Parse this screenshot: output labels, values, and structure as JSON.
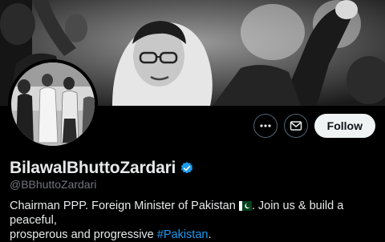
{
  "profile": {
    "display_name": "BilawalBhuttoZardari",
    "handle": "@BBhuttoZardari",
    "verified": true,
    "bio_lines": {
      "part1": "Chairman PPP. Foreign Minister of Pakistan",
      "part2": ". Join us & build a peaceful,",
      "part3": "prosperous and progressive",
      "hashtag": "#Pakistan",
      "end": "."
    }
  },
  "actions": {
    "more_icon": "more-horizontal-icon",
    "message_icon": "envelope-icon",
    "follow_label": "Follow"
  },
  "colors": {
    "background": "#000000",
    "verified_badge": "#1d9bf0",
    "hashtag": "#1d9bf0",
    "follow_bg": "#eff3f4"
  }
}
